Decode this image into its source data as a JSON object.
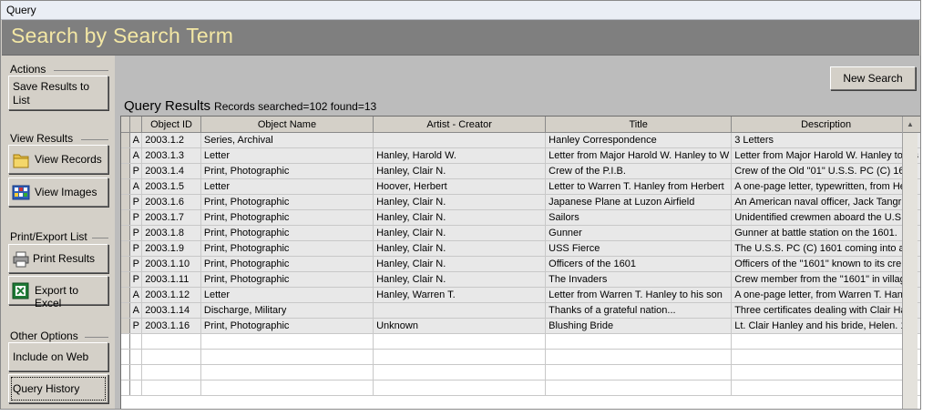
{
  "window": {
    "title": "Query"
  },
  "header": {
    "title": "Search by Search Term"
  },
  "sidebar": {
    "actions": {
      "label": "Actions",
      "save_results": "Save Results to List"
    },
    "view_results": {
      "label": "View Results",
      "view_records": "View Records",
      "view_images": "View Images"
    },
    "print_export": {
      "label": "Print/Export List",
      "print_results": "Print Results",
      "export_excel": "Export to Excel"
    },
    "other_options": {
      "label": "Other Options",
      "include_web": "Include on Web",
      "query_history": "Query History"
    }
  },
  "main": {
    "new_search": "New Search",
    "query_results_label": "Query Results",
    "records_info": "Records searched=102 found=13",
    "columns": {
      "object_id": "Object ID",
      "object_name": "Object Name",
      "artist": "Artist - Creator",
      "title": "Title",
      "description": "Description"
    },
    "rows": [
      {
        "type": "A",
        "id": "2003.1.2",
        "name": "Series, Archival",
        "artist": "",
        "title": "Hanley Correspondence",
        "desc": "3 Letters"
      },
      {
        "type": "A",
        "id": "2003.1.3",
        "name": "Letter",
        "artist": "Hanley, Harold W.",
        "title": "Letter from Major Harold W. Hanley to W",
        "desc": "Letter from Major Harold W. Hanley to his"
      },
      {
        "type": "P",
        "id": "2003.1.4",
        "name": "Print, Photographic",
        "artist": "Hanley, Clair N.",
        "title": "Crew of the P.I.B.",
        "desc": "Crew of the Old \"01\" U.S.S. PC (C) 1601"
      },
      {
        "type": "A",
        "id": "2003.1.5",
        "name": "Letter",
        "artist": "Hoover, Herbert",
        "title": "Letter to Warren T. Hanley from Herbert",
        "desc": "A one-page letter, typewritten, from Herb"
      },
      {
        "type": "P",
        "id": "2003.1.6",
        "name": "Print, Photographic",
        "artist": "Hanley, Clair N.",
        "title": "Japanese Plane at Luzon Airfield",
        "desc": "An American naval officer, Jack Tangr"
      },
      {
        "type": "P",
        "id": "2003.1.7",
        "name": "Print, Photographic",
        "artist": "Hanley, Clair N.",
        "title": "Sailors",
        "desc": "Unidentified crewmen aboard the U.S.S."
      },
      {
        "type": "P",
        "id": "2003.1.8",
        "name": "Print, Photographic",
        "artist": "Hanley, Clair N.",
        "title": "Gunner",
        "desc": "Gunner at battle station on the 1601."
      },
      {
        "type": "P",
        "id": "2003.1.9",
        "name": "Print, Photographic",
        "artist": "Hanley, Clair N.",
        "title": "USS Fierce",
        "desc": "The U.S.S. PC (C) 1601 coming into an"
      },
      {
        "type": "P",
        "id": "2003.1.10",
        "name": "Print, Photographic",
        "artist": "Hanley, Clair N.",
        "title": "Officers of the 1601",
        "desc": "Officers of the \"1601\" known to its cre"
      },
      {
        "type": "P",
        "id": "2003.1.11",
        "name": "Print, Photographic",
        "artist": "Hanley, Clair N.",
        "title": "The Invaders",
        "desc": "Crew member from the \"1601\" in village"
      },
      {
        "type": "A",
        "id": "2003.1.12",
        "name": "Letter",
        "artist": "Hanley, Warren T.",
        "title": "Letter from Warren T. Hanley to his son",
        "desc": "A one-page letter, from Warren T. Hanl"
      },
      {
        "type": "A",
        "id": "2003.1.14",
        "name": "Discharge, Military",
        "artist": "",
        "title": "Thanks of a grateful nation...",
        "desc": "Three certificates dealing with Clair Ha"
      },
      {
        "type": "P",
        "id": "2003.1.16",
        "name": "Print, Photographic",
        "artist": "Unknown",
        "title": "Blushing Bride",
        "desc": "Lt. Clair Hanley and his bride, Helen. 19"
      }
    ]
  }
}
